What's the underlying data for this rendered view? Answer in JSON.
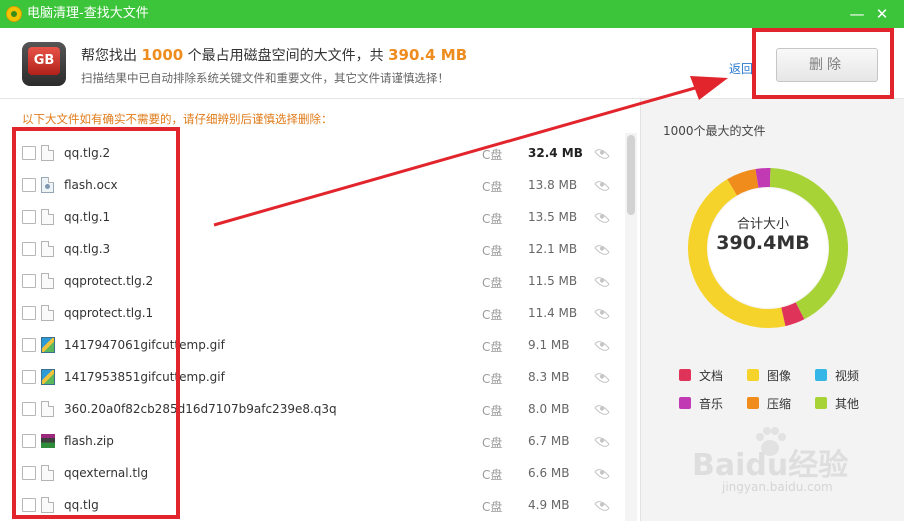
{
  "window": {
    "title": "电脑清理-查找大文件",
    "minimize_glyph": "—",
    "close_glyph": "✕",
    "logo_icon": "app-logo-icon"
  },
  "header": {
    "logo_text": "GB",
    "headline_prefix": "帮您找出",
    "headline_count": "1000",
    "headline_mid": "个最占用磁盘空间的大文件，共",
    "headline_total": "390.4 MB",
    "subline": "扫描结果中已自动排除系统关键文件和重要文件，其它文件请谨慎选择！",
    "back_label": "返回",
    "delete_label": "删除"
  },
  "notice": "以下大文件如有确实不需要的，请仔细辨别后谨慎选择删除：",
  "files": [
    {
      "name": "qq.tlg.2",
      "drive": "C盘",
      "size": "32.4 MB",
      "icon": "doc-icon",
      "kind": ""
    },
    {
      "name": "flash.ocx",
      "drive": "C盘",
      "size": "13.8 MB",
      "icon": "ocx-icon",
      "kind": "ocx"
    },
    {
      "name": "qq.tlg.1",
      "drive": "C盘",
      "size": "13.5 MB",
      "icon": "doc-icon",
      "kind": ""
    },
    {
      "name": "qq.tlg.3",
      "drive": "C盘",
      "size": "12.1 MB",
      "icon": "doc-icon",
      "kind": ""
    },
    {
      "name": "qqprotect.tlg.2",
      "drive": "C盘",
      "size": "11.5 MB",
      "icon": "doc-icon",
      "kind": ""
    },
    {
      "name": "qqprotect.tlg.1",
      "drive": "C盘",
      "size": "11.4 MB",
      "icon": "doc-icon",
      "kind": ""
    },
    {
      "name": "1417947061gifcuttemp.gif",
      "drive": "C盘",
      "size": "9.1 MB",
      "icon": "gif-icon",
      "kind": "gif"
    },
    {
      "name": "1417953851gifcuttemp.gif",
      "drive": "C盘",
      "size": "8.3 MB",
      "icon": "gif-icon",
      "kind": "gif"
    },
    {
      "name": "360.20a0f82cb285d16d7107b9afc239e8.q3q",
      "drive": "C盘",
      "size": "8.0 MB",
      "icon": "doc-icon",
      "kind": ""
    },
    {
      "name": "flash.zip",
      "drive": "C盘",
      "size": "6.7 MB",
      "icon": "zip-icon",
      "kind": "zip"
    },
    {
      "name": "qqexternal.tlg",
      "drive": "C盘",
      "size": "6.6 MB",
      "icon": "doc-icon",
      "kind": ""
    },
    {
      "name": "qq.tlg",
      "drive": "C盘",
      "size": "4.9 MB",
      "icon": "doc-icon",
      "kind": ""
    }
  ],
  "summary": {
    "title": "1000个最大的文件",
    "donut_label": "合计大小",
    "donut_value": "390.4MB",
    "segments": [
      {
        "name": "文档",
        "fraction": 0.04,
        "color": "#e0335a"
      },
      {
        "name": "图像",
        "fraction": 0.45,
        "color": "#f6d32b"
      },
      {
        "name": "视频",
        "fraction": 0.0,
        "color": "#34b6e6"
      },
      {
        "name": "音乐",
        "fraction": 0.03,
        "color": "#c13ab4"
      },
      {
        "name": "压缩",
        "fraction": 0.06,
        "color": "#f08c1c"
      },
      {
        "name": "其他",
        "fraction": 0.42,
        "color": "#a8d336"
      }
    ]
  },
  "watermark": {
    "main": "Baidu经验",
    "sub": "jingyan.baidu.com"
  }
}
